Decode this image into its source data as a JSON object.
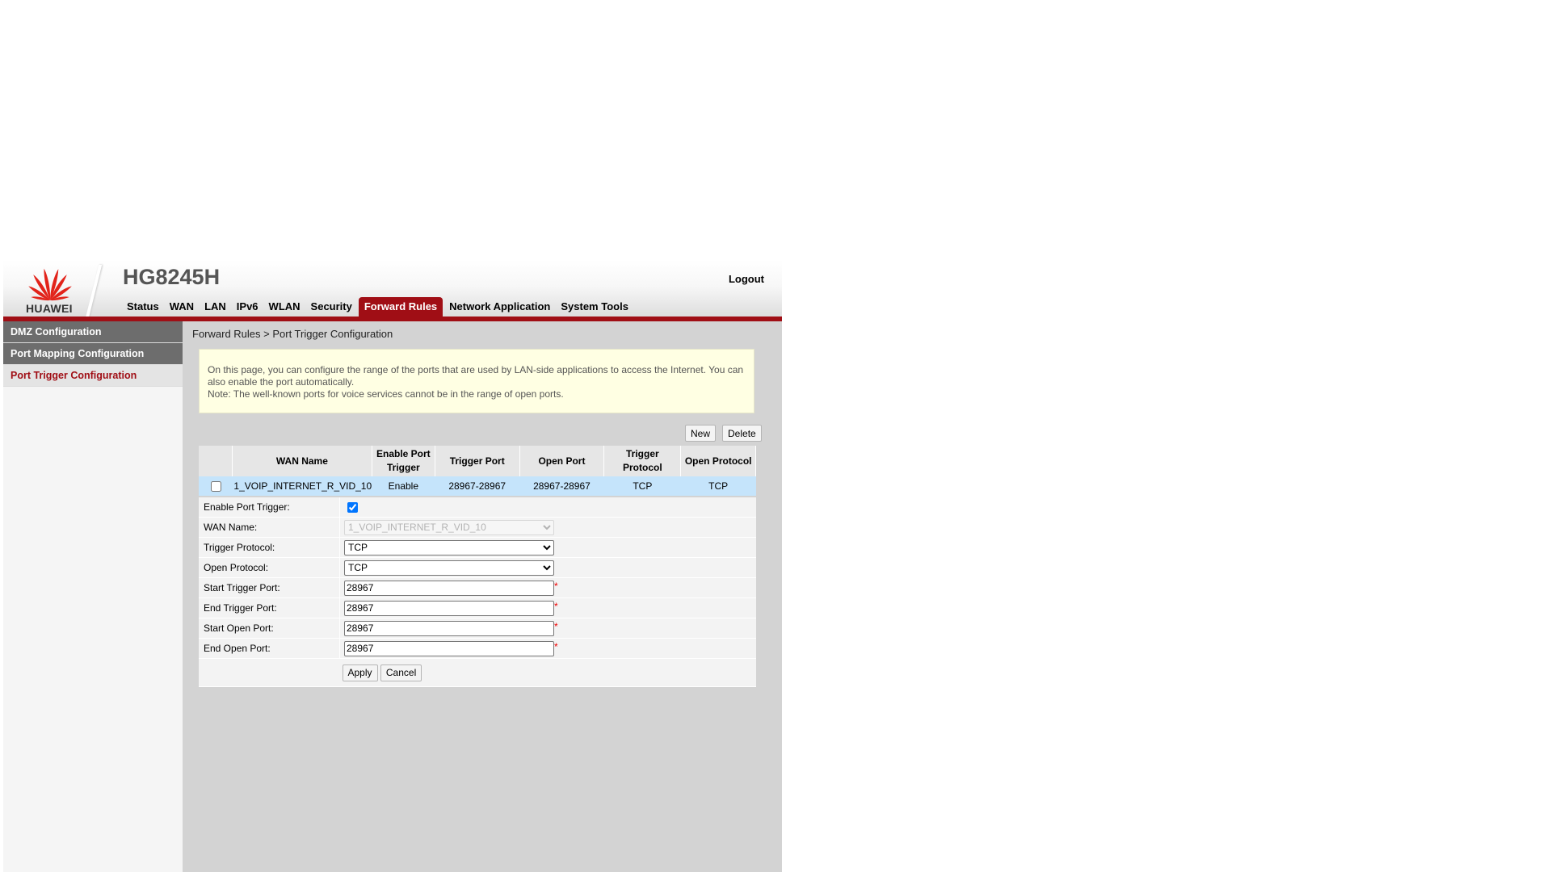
{
  "header": {
    "brand": "HUAWEI",
    "model": "HG8245H",
    "logout_label": "Logout",
    "nav": [
      "Status",
      "WAN",
      "LAN",
      "IPv6",
      "WLAN",
      "Security",
      "Forward Rules",
      "Network Application",
      "System Tools"
    ],
    "active_nav": "Forward Rules"
  },
  "sidebar": {
    "items": [
      "DMZ Configuration",
      "Port Mapping Configuration",
      "Port Trigger Configuration"
    ],
    "current": "Port Trigger Configuration"
  },
  "breadcrumb": "Forward Rules > Port Trigger Configuration",
  "info": {
    "line1": "On this page, you can configure the range of the ports that are used by LAN-side applications to access the Internet. You can also enable the port automatically.",
    "line2": "Note: The well-known ports for voice services cannot be in the range of open ports."
  },
  "buttons": {
    "new_label": "New",
    "delete_label": "Delete",
    "apply_label": "Apply",
    "cancel_label": "Cancel"
  },
  "table": {
    "headers": [
      "WAN Name",
      "Enable Port Trigger",
      "Trigger Port",
      "Open Port",
      "Trigger Protocol",
      "Open Protocol"
    ],
    "rows": [
      [
        "1_VOIP_INTERNET_R_VID_10",
        "Enable",
        "28967-28967",
        "28967-28967",
        "TCP",
        "TCP"
      ]
    ]
  },
  "form": {
    "enable_label": "Enable Port Trigger:",
    "wan_label": "WAN Name:",
    "wan_value": "1_VOIP_INTERNET_R_VID_10",
    "trigger_protocol_label": "Trigger Protocol:",
    "trigger_protocol_value": "TCP",
    "open_protocol_label": "Open Protocol:",
    "open_protocol_value": "TCP",
    "start_trigger_label": "Start Trigger Port:",
    "start_trigger_value": "28967",
    "end_trigger_label": "End Trigger Port:",
    "end_trigger_value": "28967",
    "start_open_label": "Start Open Port:",
    "start_open_value": "28967",
    "end_open_label": "End Open Port:",
    "end_open_value": "28967",
    "required_mark": "*"
  },
  "colors": {
    "brand_red": "#a00e15",
    "row_highlight": "#c5e4fb",
    "info_bg": "#ffffe3"
  }
}
